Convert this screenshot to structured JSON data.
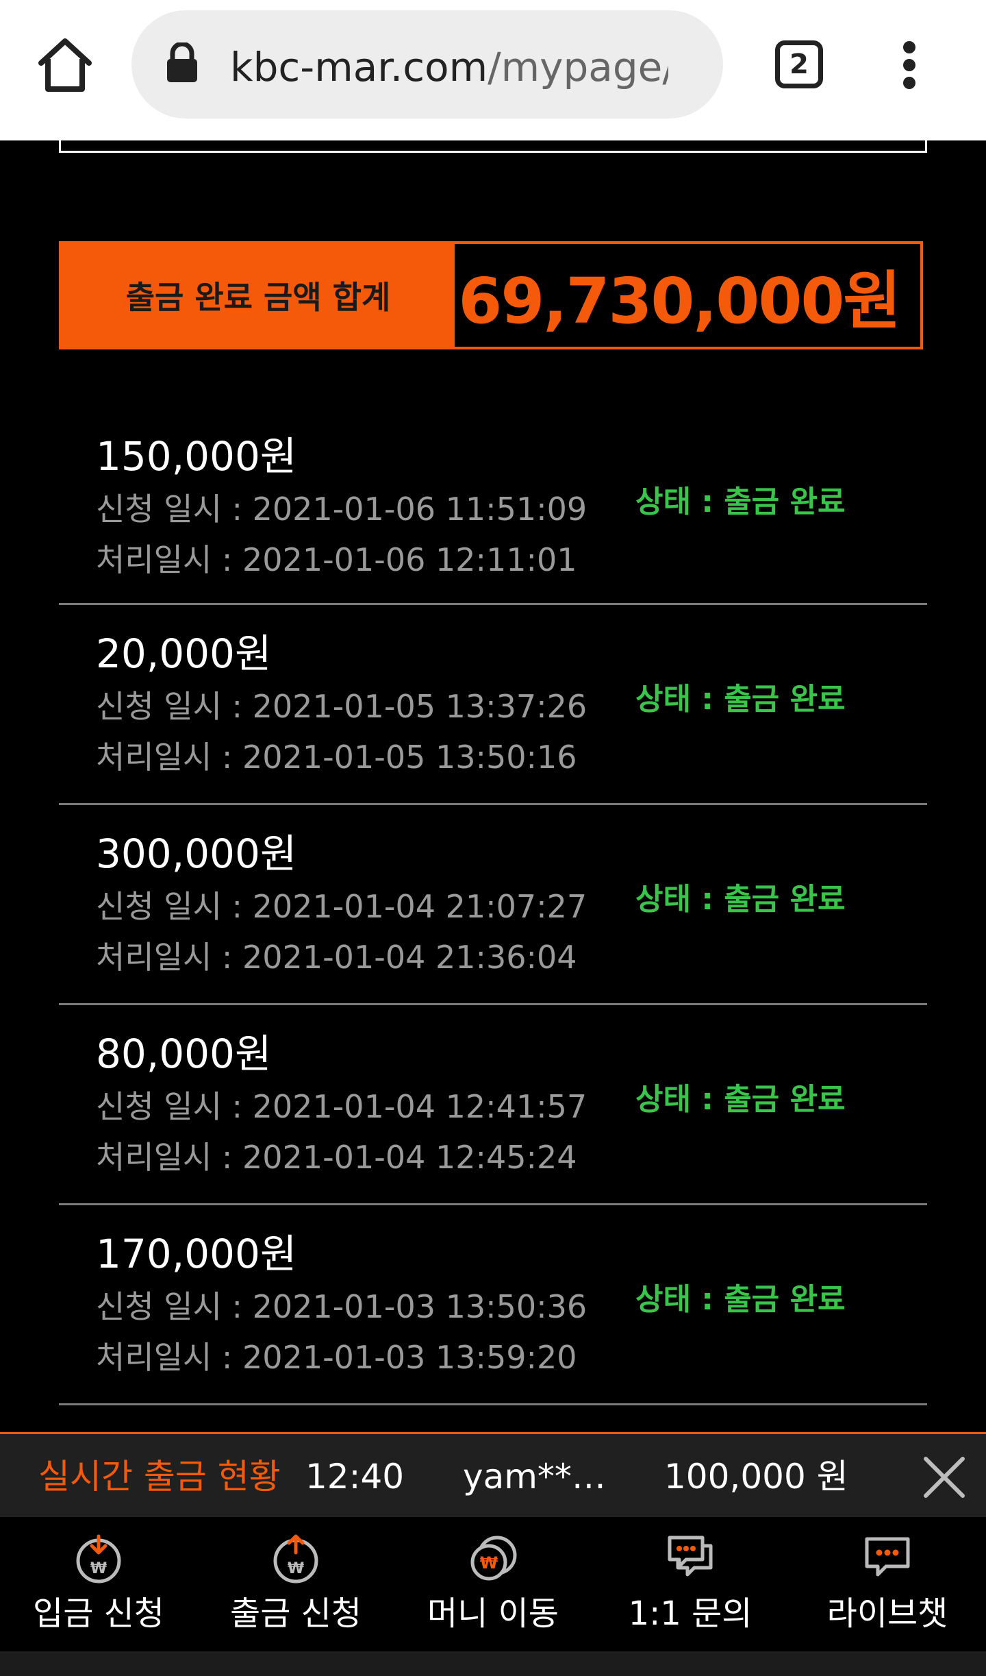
{
  "browser": {
    "url_host": "kbc-mar.com",
    "url_path": "/mypage/",
    "tab_count": "2",
    "icons": [
      "home-icon",
      "lock-icon",
      "menu-icon"
    ]
  },
  "summary": {
    "label": "출금 완료 금액 합계",
    "value": "69,730,000원",
    "accent_color": "#f55a0a"
  },
  "withdrawals": [
    {
      "amount": "150,000원",
      "requested": "신청 일시 : 2021-01-06 11:51:09",
      "processed": "처리일시 : 2021-01-06 12:11:01",
      "status": "상태 : 출금 완료"
    },
    {
      "amount": "20,000원",
      "requested": "신청 일시 : 2021-01-05 13:37:26",
      "processed": "처리일시 : 2021-01-05 13:50:16",
      "status": "상태 : 출금 완료"
    },
    {
      "amount": "300,000원",
      "requested": "신청 일시 : 2021-01-04 21:07:27",
      "processed": "처리일시 : 2021-01-04 21:36:04",
      "status": "상태 : 출금 완료"
    },
    {
      "amount": "80,000원",
      "requested": "신청 일시 : 2021-01-04 12:41:57",
      "processed": "처리일시 : 2021-01-04 12:45:24",
      "status": "상태 : 출금 완료"
    },
    {
      "amount": "170,000원",
      "requested": "신청 일시 : 2021-01-03 13:50:36",
      "processed": "처리일시 : 2021-01-03 13:59:20",
      "status": "상태 : 출금 완료"
    }
  ],
  "ticker": {
    "title": "실시간 출금 현황",
    "time": "12:40",
    "user": "yam**…",
    "amount": "100,000 원"
  },
  "nav": [
    {
      "label": "입금 신청",
      "icon": "deposit-icon"
    },
    {
      "label": "출금 신청",
      "icon": "withdraw-icon"
    },
    {
      "label": "머니 이동",
      "icon": "money-transfer-icon"
    },
    {
      "label": "1:1 문의",
      "icon": "chat-bubbles-icon"
    },
    {
      "label": "라이브챗",
      "icon": "live-chat-icon"
    }
  ]
}
